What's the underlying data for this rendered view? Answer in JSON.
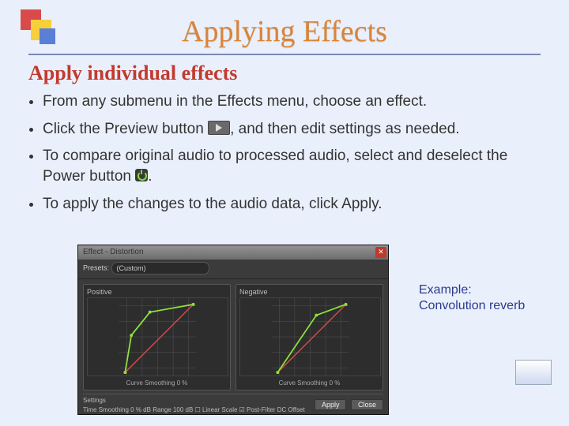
{
  "title": "Applying Effects",
  "subhead": "Apply individual effects",
  "bullets": {
    "b1": "From any submenu in the Effects menu, choose an effect.",
    "b2_pre": "Click the Preview button ",
    "b2_post": ", and then edit settings as needed.",
    "b3_pre": "To compare original audio to processed audio, select and deselect the Power button ",
    "b3_post": ".",
    "b4": "To apply the changes to the audio data, click Apply."
  },
  "dialog": {
    "title": "Effect - Distortion",
    "presets_label": "Presets:",
    "presets_value": "(Custom)",
    "pos_label": "Positive",
    "neg_label": "Negative",
    "curve_footer": "Curve Smoothing   0   %",
    "settings_label": "Settings",
    "settings_row": "Time Smoothing 0 %   dB Range 100 dB   ☐ Linear Scale   ☑ Post-Filter DC Offset",
    "apply_btn": "Apply",
    "close_btn": "Close",
    "x": "✕"
  },
  "example": "Example:\nConvolution reverb",
  "page_num": ""
}
